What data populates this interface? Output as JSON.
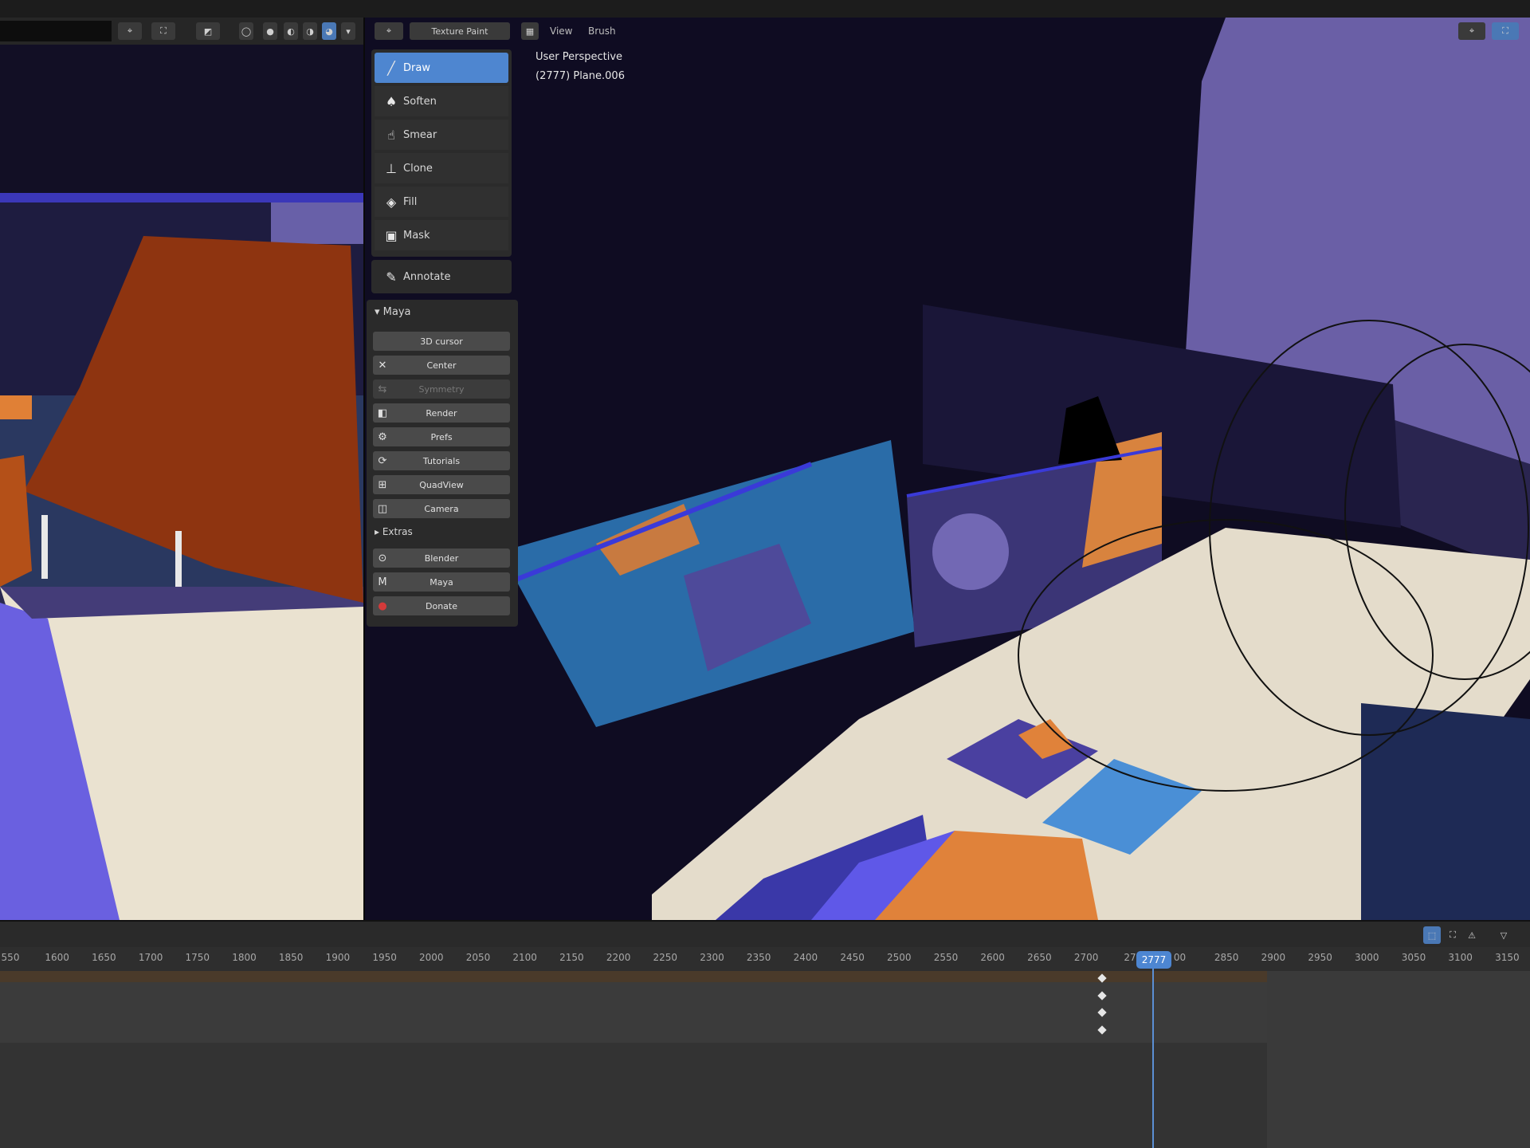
{
  "header_left": {
    "icons": [
      "brush-mode-icon",
      "overlay-icon",
      "shading-icon",
      "xray-icon",
      "solid-icon",
      "material-icon",
      "rendered-icon"
    ]
  },
  "header_right": {
    "mode_label": "Texture Paint",
    "menus": [
      "View",
      "Brush"
    ]
  },
  "viewport_overlay": {
    "line1": "User Perspective",
    "line2": "(2777) Plane.006"
  },
  "toolbar": {
    "tools": [
      {
        "label": "Draw",
        "icon": "draw-brush-icon",
        "glyph": "╱",
        "active": true
      },
      {
        "label": "Soften",
        "icon": "soften-icon",
        "glyph": "💧",
        "active": false
      },
      {
        "label": "Smear",
        "icon": "smear-icon",
        "glyph": "☝",
        "active": false
      },
      {
        "label": "Clone",
        "icon": "clone-stamp-icon",
        "glyph": "⊥",
        "active": false
      },
      {
        "label": "Fill",
        "icon": "fill-bucket-icon",
        "glyph": "◈",
        "active": false
      },
      {
        "label": "Mask",
        "icon": "mask-icon",
        "glyph": "▣",
        "active": false
      }
    ],
    "annotate": {
      "label": "Annotate",
      "icon": "annotate-icon",
      "glyph": "✎"
    }
  },
  "maya_panel": {
    "title": "Maya",
    "buttons": [
      {
        "label": "3D cursor",
        "icon": "",
        "disabled": false
      },
      {
        "label": "Center",
        "icon": "✕",
        "disabled": false
      },
      {
        "label": "Symmetry",
        "icon": "⇆",
        "disabled": true
      },
      {
        "label": "Render",
        "icon": "◧",
        "disabled": false
      },
      {
        "label": "Prefs",
        "icon": "⚙",
        "disabled": false
      },
      {
        "label": "Tutorials",
        "icon": "⟳",
        "disabled": false
      },
      {
        "label": "QuadView",
        "icon": "⊞",
        "disabled": false
      },
      {
        "label": "Camera",
        "icon": "◫",
        "disabled": false
      }
    ],
    "extras_label": "Extras",
    "extra_buttons": [
      {
        "label": "Blender",
        "icon": "⊙",
        "disabled": false
      },
      {
        "label": "Maya",
        "icon": "M",
        "disabled": false
      },
      {
        "label": "Donate",
        "icon": "●",
        "disabled": false
      }
    ]
  },
  "timeline": {
    "ticks": [
      "550",
      "1600",
      "1650",
      "1700",
      "1750",
      "1800",
      "1850",
      "1900",
      "1950",
      "2000",
      "2050",
      "2100",
      "2150",
      "2200",
      "2250",
      "2300",
      "2350",
      "2400",
      "2450",
      "2500",
      "2550",
      "2600",
      "2650",
      "2700",
      "275",
      "00",
      "2850",
      "2900",
      "2950",
      "3000",
      "3050",
      "3100",
      "3150"
    ],
    "current_frame": "2777"
  },
  "colors": {
    "accent": "#4e86d0",
    "viewport_bg": "#0f0c22",
    "orange": "#e0823a",
    "rust": "#8e3410",
    "purple": "#6a5fa6",
    "desk": "#e4dccb"
  }
}
